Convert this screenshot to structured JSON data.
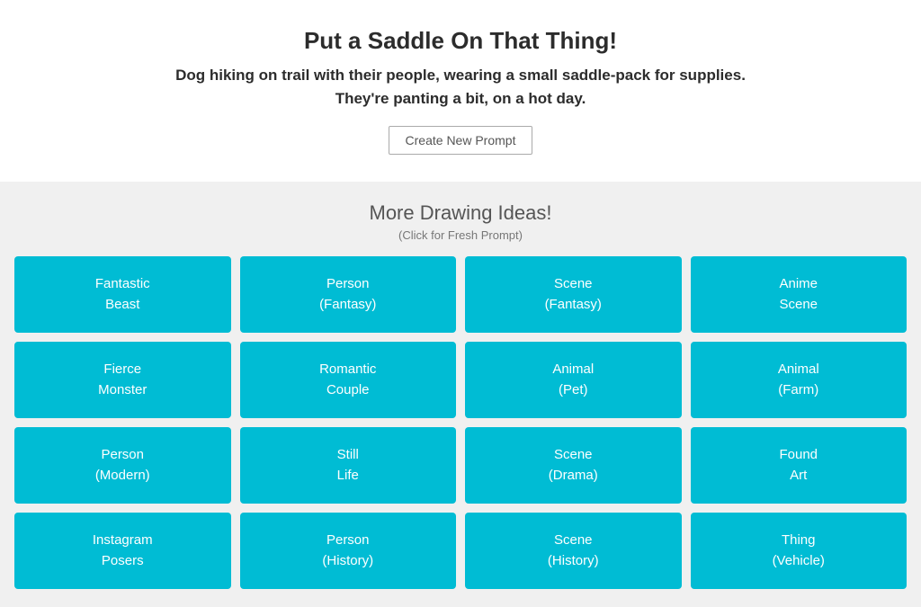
{
  "header": {
    "title": "Put a Saddle On That Thing!",
    "subtitle_line1": "Dog hiking on trail with their people, wearing a small saddle-pack for supplies.",
    "subtitle_line2": "They're panting a bit, on a hot day.",
    "create_button_label": "Create New Prompt"
  },
  "drawing_section": {
    "title": "More Drawing Ideas!",
    "subtitle": "(Click for Fresh Prompt)",
    "cards": [
      {
        "line1": "Fantastic",
        "line2": "Beast"
      },
      {
        "line1": "Person",
        "line2": "(Fantasy)"
      },
      {
        "line1": "Scene",
        "line2": "(Fantasy)"
      },
      {
        "line1": "Anime",
        "line2": "Scene"
      },
      {
        "line1": "Fierce",
        "line2": "Monster"
      },
      {
        "line1": "Romantic",
        "line2": "Couple"
      },
      {
        "line1": "Animal",
        "line2": "(Pet)"
      },
      {
        "line1": "Animal",
        "line2": "(Farm)"
      },
      {
        "line1": "Person",
        "line2": "(Modern)"
      },
      {
        "line1": "Still",
        "line2": "Life"
      },
      {
        "line1": "Scene",
        "line2": "(Drama)"
      },
      {
        "line1": "Found",
        "line2": "Art"
      },
      {
        "line1": "Instagram",
        "line2": "Posers"
      },
      {
        "line1": "Person",
        "line2": "(History)"
      },
      {
        "line1": "Scene",
        "line2": "(History)"
      },
      {
        "line1": "Thing",
        "line2": "(Vehicle)"
      }
    ]
  }
}
